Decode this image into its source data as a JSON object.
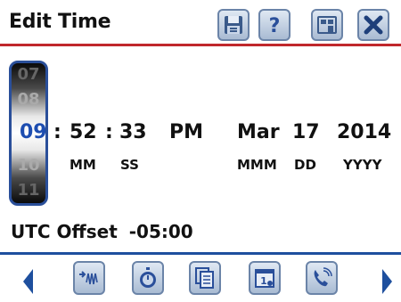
{
  "header": {
    "title": "Edit Time",
    "buttons": [
      "save",
      "help",
      "home",
      "close"
    ]
  },
  "roller": {
    "values": [
      "07",
      "08",
      "09",
      "10",
      "11"
    ],
    "selected": "09"
  },
  "time": {
    "minute": "52",
    "second": "33",
    "sep1": ":",
    "sep2": ":",
    "ampm": "PM",
    "month": "Mar",
    "day": "17",
    "year": "2014"
  },
  "labels": {
    "mm": "MM",
    "ss": "SS",
    "mmm": "MMM",
    "dd": "DD",
    "yyyy": "YYYY"
  },
  "utc": {
    "label": "UTC Offset",
    "value": "-05:00"
  },
  "toolbar": {
    "items": [
      "waveform-icon",
      "stopwatch-icon",
      "documents-icon",
      "calendar-icon",
      "phone-icon"
    ]
  },
  "colors": {
    "accent_red": "#c0282c",
    "accent_blue": "#1e4f9e",
    "selected_hour": "#1d4db0"
  }
}
